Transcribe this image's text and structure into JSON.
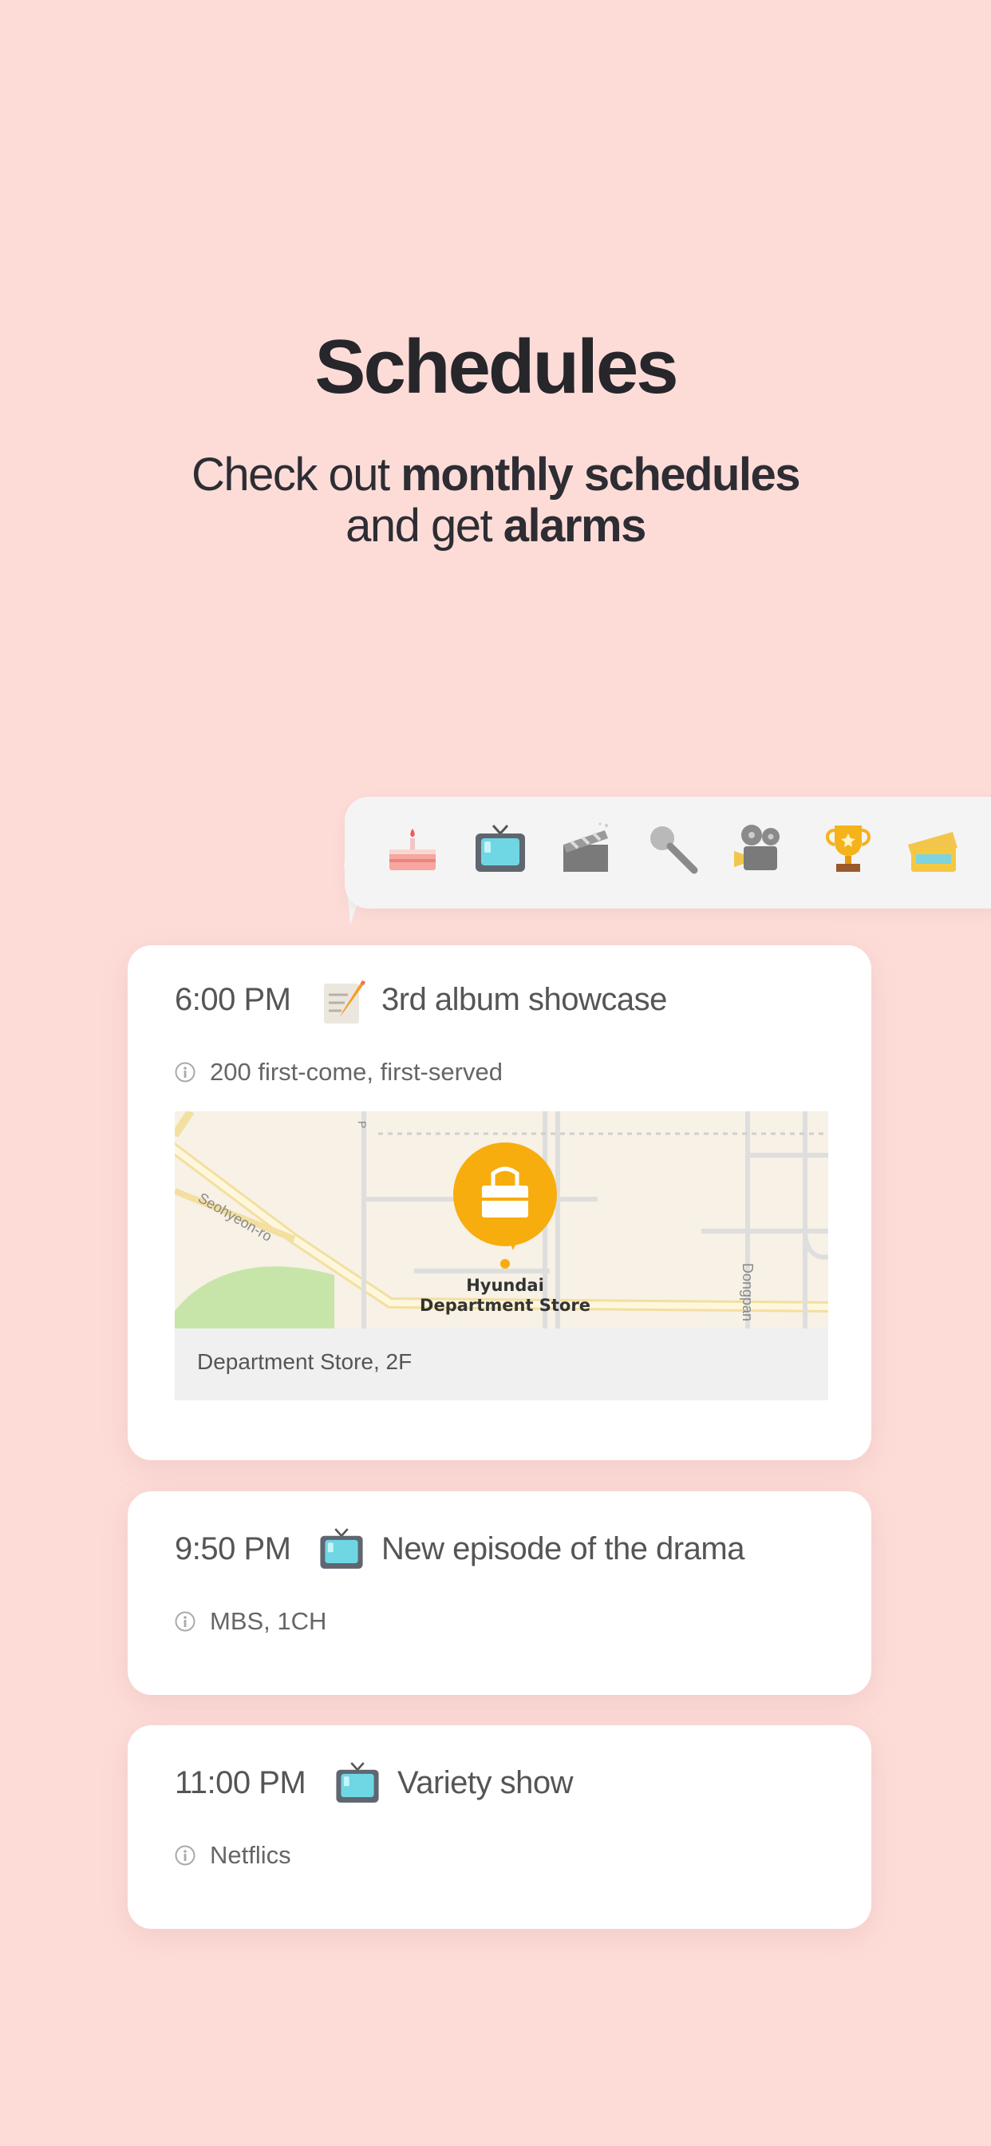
{
  "header": {
    "title": "Schedules",
    "subtitle_line1_prefix": "Check out ",
    "subtitle_line1_bold": "monthly schedules",
    "subtitle_line2_prefix": "and get ",
    "subtitle_line2_bold": "alarms"
  },
  "categories": [
    {
      "name": "birthday",
      "icon": "cake-icon"
    },
    {
      "name": "broadcast",
      "icon": "tv-icon"
    },
    {
      "name": "movie",
      "icon": "clapperboard-icon"
    },
    {
      "name": "concert",
      "icon": "microphone-icon"
    },
    {
      "name": "video",
      "icon": "film-camera-icon"
    },
    {
      "name": "award",
      "icon": "trophy-icon"
    },
    {
      "name": "ticket",
      "icon": "ticket-icon"
    }
  ],
  "events": [
    {
      "time": "6:00 PM",
      "icon": "memo-icon",
      "title": "3rd album showcase",
      "info": "200 first-come, first-served",
      "map": {
        "road_label": "Seohyeon-ro",
        "road_label_right": "Dongpan",
        "road_label_top": "P",
        "place_line1": "Hyundai",
        "place_line2": "Department Store",
        "place_detail": "Department Store, 2F"
      }
    },
    {
      "time": "9:50 PM",
      "icon": "tv-icon",
      "title": "New episode of the drama",
      "info": "MBS, 1CH"
    },
    {
      "time": "11:00 PM",
      "icon": "tv-icon",
      "title": "Variety show",
      "info": "Netflics"
    }
  ],
  "colors": {
    "background": "#fddcd8",
    "map_pin": "#f7ad0e",
    "card": "#ffffff"
  }
}
